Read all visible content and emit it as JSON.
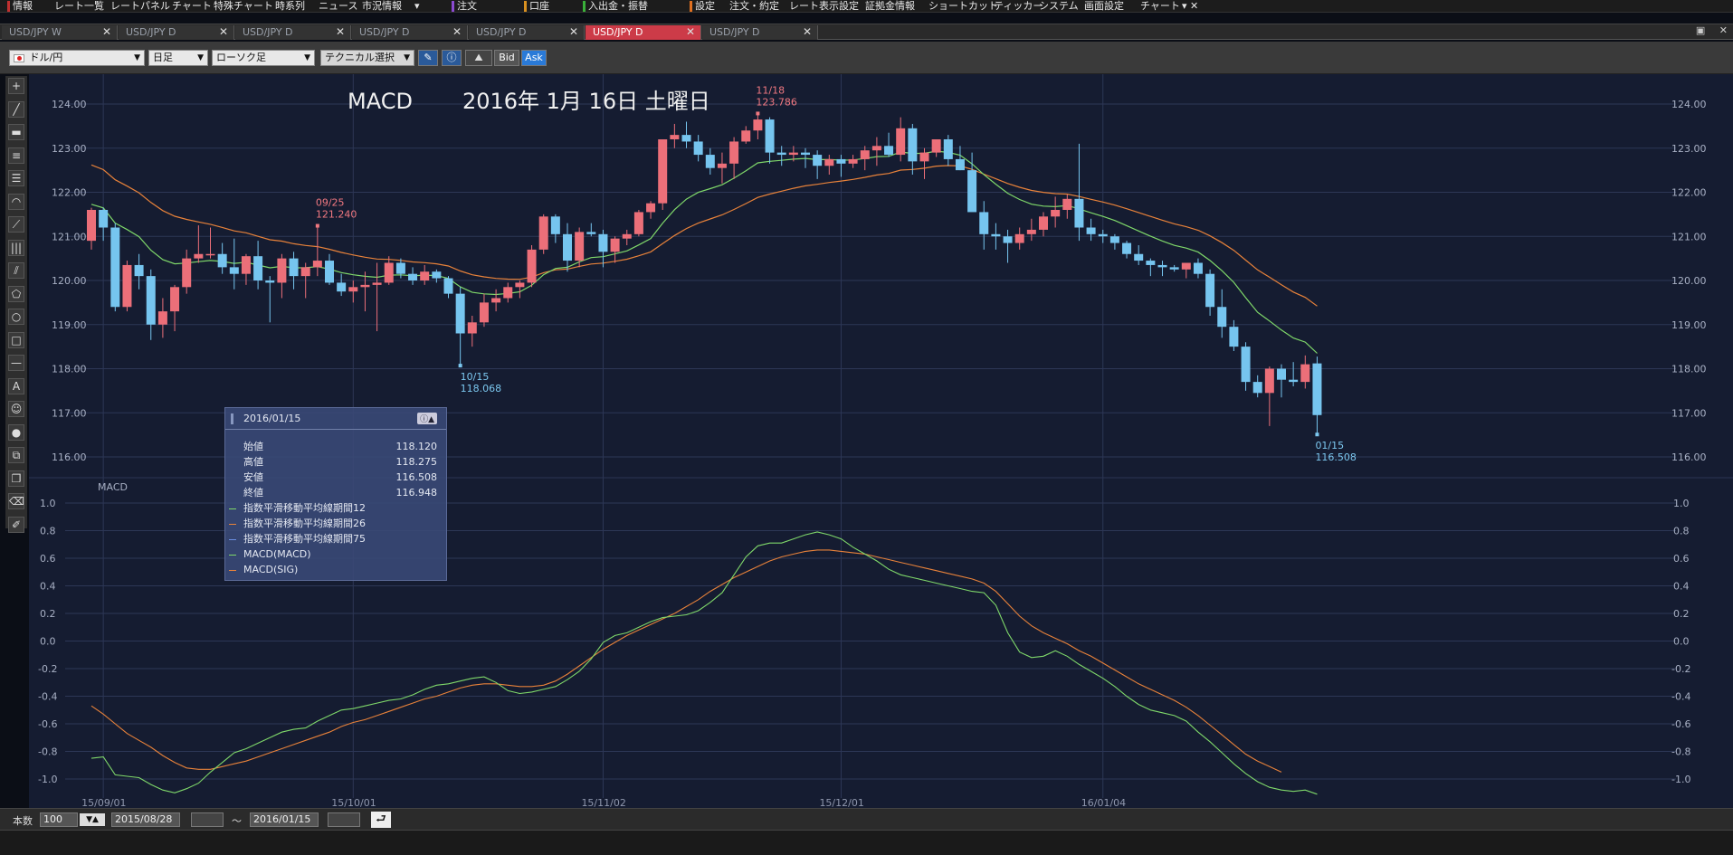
{
  "menu": [
    "情報",
    "レート一覧",
    "レートパネル",
    "チャート",
    "特殊チャート",
    "時系列",
    "ニュース",
    "市況情報",
    "注文",
    "口座",
    "入出金・振替",
    "設定",
    "注文・約定",
    "レート表示設定",
    "証拠金情報",
    "ショートカット",
    "ティッカー",
    "システム",
    "画面設定",
    "チャート"
  ],
  "tabs": [
    {
      "label": "USD/JPY W",
      "active": false
    },
    {
      "label": "USD/JPY D",
      "active": false
    },
    {
      "label": "USD/JPY D",
      "active": false
    },
    {
      "label": "USD/JPY D",
      "active": false
    },
    {
      "label": "USD/JPY D",
      "active": false
    },
    {
      "label": "USD/JPY D",
      "active": true
    },
    {
      "label": "USD/JPY D",
      "active": false
    }
  ],
  "toolbar": {
    "pair": "ドル/円",
    "period": "日足",
    "chart_type": "ローソク足",
    "technical": "テクニカル選択",
    "bid": "Bid",
    "ask": "Ask"
  },
  "chart_title": {
    "indicator": "MACD",
    "date": "2016年 1月 16日 土曜日"
  },
  "macd_label": "MACD",
  "infobox": {
    "date": "2016/01/15",
    "rows": [
      [
        "始値",
        "118.120"
      ],
      [
        "高値",
        "118.275"
      ],
      [
        "安値",
        "116.508"
      ],
      [
        "終値",
        "116.948"
      ]
    ],
    "legend": [
      {
        "name": "指数平滑移動平均線期間12",
        "color": "#7fd86a"
      },
      {
        "name": "指数平滑移動平均線期間26",
        "color": "#e8823a"
      },
      {
        "name": "指数平滑移動平均線期間75",
        "color": "#6a8ee0"
      },
      {
        "name": "MACD(MACD)",
        "color": "#7fd86a"
      },
      {
        "name": "MACD(SIG)",
        "color": "#e8823a"
      }
    ]
  },
  "annotations": [
    {
      "date": "09/25",
      "price": "121.240",
      "color": "#f07880"
    },
    {
      "date": "10/15",
      "price": "118.068",
      "color": "#7cc8f0"
    },
    {
      "date": "11/18",
      "price": "123.786",
      "color": "#f07880"
    },
    {
      "date": "01/15",
      "price": "116.508",
      "color": "#7cc8f0"
    }
  ],
  "bottom": {
    "count_label": "本数",
    "count": "100",
    "from": "2015/08/28",
    "tilde": "〜",
    "to": "2016/01/15"
  },
  "colors": {
    "up": "#ec6f79",
    "down": "#76c5ef",
    "ema12": "#7fd86a",
    "ema26": "#e8823a",
    "grid": "#2d3756",
    "bg": "#151c31"
  },
  "chart_data": [
    {
      "type": "candlestick",
      "x_labels": [
        "15/09/01",
        "15/10/01",
        "15/11/02",
        "15/12/01",
        "16/01/04"
      ],
      "x_label_index": [
        1,
        22,
        43,
        63,
        85
      ],
      "ylim": [
        116.0,
        124.0
      ],
      "y_ticks": [
        "124.00",
        "123.00",
        "122.00",
        "121.00",
        "120.00",
        "119.00",
        "118.00",
        "117.00",
        "116.00"
      ],
      "ohlc": [
        [
          120.9,
          121.65,
          120.7,
          121.6
        ],
        [
          121.6,
          121.65,
          120.9,
          121.2
        ],
        [
          121.2,
          121.3,
          119.3,
          119.4
        ],
        [
          119.4,
          120.45,
          119.3,
          120.35
        ],
        [
          120.35,
          120.6,
          119.8,
          120.1
        ],
        [
          120.1,
          120.25,
          118.65,
          119.0
        ],
        [
          119.0,
          119.6,
          118.7,
          119.3
        ],
        [
          119.3,
          119.9,
          118.85,
          119.85
        ],
        [
          119.85,
          120.7,
          119.7,
          120.5
        ],
        [
          120.5,
          121.25,
          120.4,
          120.6
        ],
        [
          120.6,
          121.2,
          120.5,
          120.6
        ],
        [
          120.6,
          120.85,
          120.15,
          120.3
        ],
        [
          120.3,
          120.95,
          119.8,
          120.15
        ],
        [
          120.15,
          120.6,
          119.9,
          120.55
        ],
        [
          120.55,
          120.9,
          119.8,
          120.0
        ],
        [
          120.0,
          120.1,
          119.05,
          119.95
        ],
        [
          119.95,
          120.6,
          119.6,
          120.5
        ],
        [
          120.5,
          120.65,
          119.8,
          120.1
        ],
        [
          120.1,
          120.4,
          119.6,
          120.3
        ],
        [
          120.3,
          121.24,
          120.1,
          120.45
        ],
        [
          120.45,
          120.6,
          119.9,
          119.95
        ],
        [
          119.95,
          120.15,
          119.65,
          119.75
        ],
        [
          119.75,
          120.0,
          119.5,
          119.85
        ],
        [
          119.85,
          120.2,
          119.3,
          119.9
        ],
        [
          119.9,
          120.4,
          118.85,
          119.95
        ],
        [
          119.95,
          120.55,
          119.9,
          120.4
        ],
        [
          120.4,
          120.5,
          120.05,
          120.15
        ],
        [
          120.15,
          120.3,
          119.9,
          120.0
        ],
        [
          120.0,
          120.35,
          119.9,
          120.2
        ],
        [
          120.2,
          120.25,
          119.95,
          120.05
        ],
        [
          120.05,
          120.1,
          119.6,
          119.7
        ],
        [
          119.7,
          119.85,
          118.07,
          118.8
        ],
        [
          118.8,
          119.2,
          118.5,
          119.05
        ],
        [
          119.05,
          119.7,
          118.95,
          119.5
        ],
        [
          119.5,
          119.8,
          119.3,
          119.6
        ],
        [
          119.6,
          119.95,
          119.5,
          119.85
        ],
        [
          119.85,
          120.0,
          119.6,
          119.95
        ],
        [
          119.95,
          120.8,
          119.85,
          120.7
        ],
        [
          120.7,
          121.5,
          120.6,
          121.45
        ],
        [
          121.45,
          121.5,
          120.85,
          121.05
        ],
        [
          121.05,
          121.3,
          120.2,
          120.45
        ],
        [
          120.45,
          121.2,
          120.3,
          121.1
        ],
        [
          121.1,
          121.3,
          121.0,
          121.05
        ],
        [
          121.05,
          121.15,
          120.3,
          120.65
        ],
        [
          120.65,
          121.0,
          120.4,
          120.95
        ],
        [
          120.95,
          121.15,
          120.8,
          121.05
        ],
        [
          121.05,
          121.6,
          121.0,
          121.55
        ],
        [
          121.55,
          121.8,
          121.4,
          121.75
        ],
        [
          121.75,
          123.2,
          121.6,
          123.2
        ],
        [
          123.2,
          123.55,
          123.0,
          123.3
        ],
        [
          123.3,
          123.6,
          123.0,
          123.15
        ],
        [
          123.15,
          123.3,
          122.7,
          122.85
        ],
        [
          122.85,
          123.0,
          122.4,
          122.55
        ],
        [
          122.55,
          122.9,
          122.2,
          122.65
        ],
        [
          122.65,
          123.25,
          122.3,
          123.15
        ],
        [
          123.15,
          123.5,
          123.1,
          123.4
        ],
        [
          123.4,
          123.786,
          123.2,
          123.65
        ],
        [
          123.65,
          123.7,
          122.65,
          122.9
        ],
        [
          122.9,
          123.05,
          122.6,
          122.85
        ],
        [
          122.85,
          123.05,
          122.7,
          122.9
        ],
        [
          122.9,
          123.0,
          122.55,
          122.85
        ],
        [
          122.85,
          122.95,
          122.3,
          122.6
        ],
        [
          122.6,
          122.85,
          122.4,
          122.75
        ],
        [
          122.75,
          122.85,
          122.35,
          122.65
        ],
        [
          122.65,
          122.85,
          122.55,
          122.75
        ],
        [
          122.75,
          123.05,
          122.5,
          122.95
        ],
        [
          122.95,
          123.25,
          122.6,
          123.05
        ],
        [
          123.05,
          123.35,
          122.8,
          122.85
        ],
        [
          122.85,
          123.7,
          122.7,
          123.45
        ],
        [
          123.45,
          123.55,
          122.4,
          122.7
        ],
        [
          122.7,
          123.0,
          122.3,
          122.9
        ],
        [
          122.9,
          123.2,
          122.8,
          123.2
        ],
        [
          123.2,
          123.3,
          122.6,
          122.75
        ],
        [
          122.75,
          123.05,
          122.5,
          122.5
        ],
        [
          122.5,
          122.9,
          121.8,
          121.55
        ],
        [
          121.55,
          121.8,
          120.7,
          121.05
        ],
        [
          121.05,
          121.3,
          120.7,
          121.0
        ],
        [
          121.0,
          121.15,
          120.4,
          120.85
        ],
        [
          120.85,
          121.2,
          120.7,
          121.05
        ],
        [
          121.05,
          121.4,
          120.9,
          121.15
        ],
        [
          121.15,
          121.55,
          121.0,
          121.45
        ],
        [
          121.45,
          121.9,
          121.2,
          121.6
        ],
        [
          121.6,
          121.95,
          121.4,
          121.85
        ],
        [
          121.85,
          123.1,
          120.9,
          121.2
        ],
        [
          121.2,
          121.4,
          120.9,
          121.05
        ],
        [
          121.05,
          121.15,
          120.85,
          121.0
        ],
        [
          121.0,
          121.05,
          120.7,
          120.85
        ],
        [
          120.85,
          120.9,
          120.5,
          120.6
        ],
        [
          120.6,
          120.8,
          120.35,
          120.45
        ],
        [
          120.45,
          120.5,
          120.1,
          120.35
        ],
        [
          120.35,
          120.45,
          120.1,
          120.3
        ],
        [
          120.3,
          120.35,
          120.2,
          120.25
        ],
        [
          120.25,
          120.4,
          120.05,
          120.4
        ],
        [
          120.4,
          120.5,
          120.05,
          120.15
        ],
        [
          120.15,
          120.25,
          119.2,
          119.4
        ],
        [
          119.4,
          119.8,
          118.7,
          118.95
        ],
        [
          118.95,
          119.1,
          118.4,
          118.5
        ],
        [
          118.5,
          118.6,
          117.5,
          117.7
        ],
        [
          117.7,
          117.85,
          117.35,
          117.45
        ],
        [
          117.45,
          118.05,
          116.7,
          118.0
        ],
        [
          118.0,
          118.1,
          117.35,
          117.75
        ],
        [
          117.75,
          118.15,
          117.6,
          117.7
        ],
        [
          117.7,
          118.3,
          117.55,
          118.1
        ],
        [
          118.12,
          118.275,
          116.508,
          116.948
        ]
      ]
    },
    {
      "type": "line",
      "series_names": [
        "MACD(MACD)",
        "MACD(SIG)"
      ],
      "ylim": [
        -1.0,
        1.0
      ],
      "y_ticks": [
        "1.0",
        "0.8",
        "0.6",
        "0.4",
        "0.2",
        "0.0",
        "-0.2",
        "-0.4",
        "-0.6",
        "-0.8",
        "-1.0"
      ],
      "macd": [
        -0.85,
        -0.84,
        -0.97,
        -0.98,
        -0.99,
        -1.04,
        -1.08,
        -1.1,
        -1.07,
        -1.03,
        -0.95,
        -0.88,
        -0.81,
        -0.78,
        -0.74,
        -0.7,
        -0.66,
        -0.64,
        -0.63,
        -0.58,
        -0.54,
        -0.5,
        -0.49,
        -0.47,
        -0.45,
        -0.43,
        -0.42,
        -0.39,
        -0.35,
        -0.32,
        -0.31,
        -0.29,
        -0.27,
        -0.26,
        -0.3,
        -0.36,
        -0.38,
        -0.37,
        -0.35,
        -0.33,
        -0.28,
        -0.22,
        -0.13,
        -0.01,
        0.04,
        0.06,
        0.1,
        0.14,
        0.17,
        0.18,
        0.19,
        0.22,
        0.28,
        0.35,
        0.48,
        0.61,
        0.69,
        0.71,
        0.71,
        0.74,
        0.77,
        0.79,
        0.77,
        0.74,
        0.68,
        0.63,
        0.58,
        0.52,
        0.48,
        0.46,
        0.44,
        0.42,
        0.4,
        0.38,
        0.36,
        0.35,
        0.26,
        0.06,
        -0.08,
        -0.12,
        -0.11,
        -0.07,
        -0.11,
        -0.17,
        -0.22,
        -0.27,
        -0.33,
        -0.4,
        -0.46,
        -0.5,
        -0.52,
        -0.54,
        -0.58,
        -0.66,
        -0.73,
        -0.81,
        -0.89,
        -0.96,
        -1.02,
        -1.06,
        -1.08,
        -1.09,
        -1.08,
        -1.11
      ],
      "signal": [
        -0.47,
        -0.53,
        -0.6,
        -0.67,
        -0.72,
        -0.77,
        -0.83,
        -0.88,
        -0.92,
        -0.93,
        -0.93,
        -0.91,
        -0.89,
        -0.87,
        -0.84,
        -0.81,
        -0.78,
        -0.75,
        -0.72,
        -0.69,
        -0.66,
        -0.62,
        -0.59,
        -0.57,
        -0.54,
        -0.51,
        -0.48,
        -0.45,
        -0.42,
        -0.4,
        -0.37,
        -0.34,
        -0.32,
        -0.31,
        -0.31,
        -0.32,
        -0.33,
        -0.33,
        -0.32,
        -0.29,
        -0.24,
        -0.18,
        -0.12,
        -0.06,
        -0.01,
        0.04,
        0.08,
        0.12,
        0.16,
        0.2,
        0.25,
        0.3,
        0.36,
        0.41,
        0.46,
        0.5,
        0.54,
        0.58,
        0.61,
        0.63,
        0.65,
        0.66,
        0.66,
        0.65,
        0.64,
        0.63,
        0.61,
        0.59,
        0.57,
        0.55,
        0.53,
        0.51,
        0.49,
        0.47,
        0.45,
        0.42,
        0.36,
        0.27,
        0.18,
        0.11,
        0.06,
        0.02,
        -0.02,
        -0.07,
        -0.11,
        -0.16,
        -0.21,
        -0.26,
        -0.31,
        -0.35,
        -0.39,
        -0.43,
        -0.48,
        -0.54,
        -0.61,
        -0.68,
        -0.75,
        -0.82,
        -0.87,
        -0.91,
        -0.95
      ]
    }
  ]
}
